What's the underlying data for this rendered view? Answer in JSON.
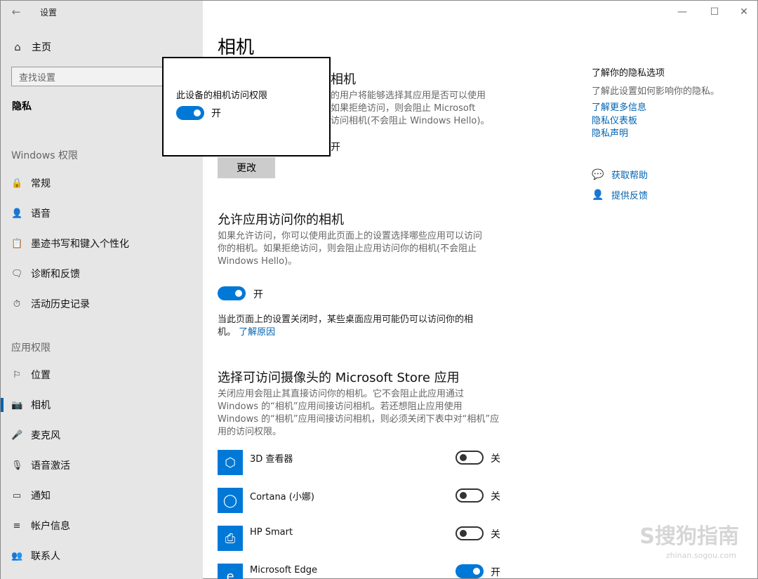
{
  "window": {
    "title": "设置",
    "back_icon": "←",
    "minimize_icon": "—",
    "maximize_icon": "☐",
    "close_icon": "✕"
  },
  "sidebar": {
    "home_icon": "⌂",
    "home_label": "主页",
    "search_placeholder": "查找设置",
    "privacy_label": "隐私",
    "group_windows": "Windows 权限",
    "windows_items": [
      {
        "icon": "🔒",
        "label": "常规"
      },
      {
        "icon": "👤",
        "label": "语音"
      },
      {
        "icon": "📋",
        "label": "墨迹书写和键入个性化"
      },
      {
        "icon": "🗨",
        "label": "诊断和反馈"
      },
      {
        "icon": "⏱",
        "label": "活动历史记录"
      }
    ],
    "group_app": "应用权限",
    "app_items": [
      {
        "icon": "⚐",
        "label": "位置"
      },
      {
        "icon": "📷",
        "label": "相机"
      },
      {
        "icon": "🎤",
        "label": "麦克风"
      },
      {
        "icon": "🎙",
        "label": "语音激活"
      },
      {
        "icon": "▭",
        "label": "通知"
      },
      {
        "icon": "≡",
        "label": "帐户信息"
      },
      {
        "icon": "👥",
        "label": "联系人"
      }
    ]
  },
  "main": {
    "page_title": "相机",
    "device_section_title_tail": "相机",
    "device_desc_lines": [
      "的用户将能够选择其应用是否可以使用",
      "如果拒绝访问，则会阻止 Microsoft",
      "访问相机(不会阻止 Windows Hello)。"
    ],
    "device_toggle_label": "开",
    "change_button": "更改",
    "allow_title": "允许应用访问你的相机",
    "allow_desc_lines": [
      "如果允许访问，你可以使用此页面上的设置选择哪些应用可以访问",
      "你的相机。如果拒绝访问，则会阻止应用访问你的相机(不会阻止",
      "Windows Hello)。"
    ],
    "allow_toggle_label": "开",
    "note_line1": "当此页面上的设置关闭时，某些桌面应用可能仍可以访问你的相",
    "note_line2": "机。",
    "note_link": "了解原因",
    "store_title": "选择可访问摄像头的 Microsoft Store 应用",
    "store_desc_lines": [
      "关闭应用会阻止其直接访问你的相机。它不会阻止此应用通过",
      "Windows 的“相机”应用间接访问相机。若还想阻止应用使用",
      "Windows 的“相机”应用间接访问相机，则必须关闭下表中对“相机”应",
      "用的访问权限。"
    ],
    "apps": [
      {
        "name": "3D 查看器",
        "icon": "⬡",
        "state": "关",
        "on": false
      },
      {
        "name": "Cortana (小娜)",
        "icon": "◯",
        "state": "关",
        "on": false
      },
      {
        "name": "HP Smart",
        "icon": "⎙",
        "state": "关",
        "on": false
      },
      {
        "name": "Microsoft Edge",
        "icon": "e",
        "state": "开",
        "on": true
      }
    ]
  },
  "popup": {
    "title": "此设备的相机访问权限",
    "toggle_label": "开"
  },
  "right_panel": {
    "title": "了解你的隐私选项",
    "desc": "了解此设置如何影响你的隐私。",
    "links": [
      "了解更多信息",
      "隐私仪表板",
      "隐私声明"
    ],
    "help_label": "获取帮助",
    "feedback_label": "提供反馈"
  },
  "watermark": {
    "text": "S搜狗指南",
    "sub": "zhinan.sogou.com"
  }
}
